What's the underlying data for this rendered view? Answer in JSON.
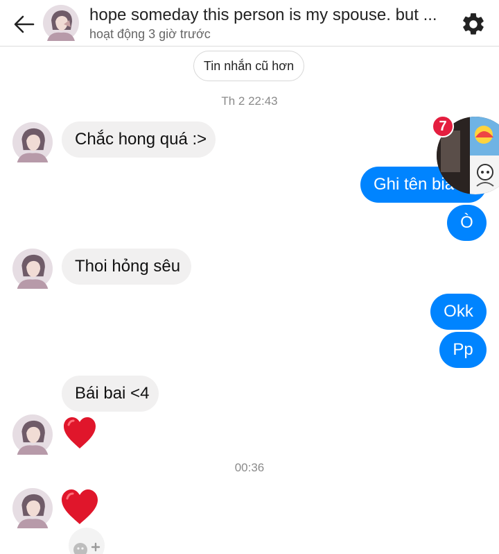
{
  "header": {
    "title": "hope someday this person is my spouse. but ...",
    "status": "hoạt động 3 giờ trước"
  },
  "older_messages_label": "Tin nhắn cũ hơn",
  "timestamps": [
    "Th 2 22:43",
    "00:36"
  ],
  "messages": [
    {
      "from": "them",
      "text": "Chắc hong quá :>"
    },
    {
      "from": "me",
      "text": "Ghi tên bia"
    },
    {
      "from": "me",
      "text": "Ò"
    },
    {
      "from": "them",
      "text": "Thoi hỏng sêu"
    },
    {
      "from": "me",
      "text": "Okk"
    },
    {
      "from": "me",
      "text": "Pp"
    },
    {
      "from": "them",
      "text": "Bái bai <4"
    },
    {
      "from": "them",
      "emoji": "heart"
    },
    {
      "from": "them",
      "emoji": "heart"
    }
  ],
  "chat_head": {
    "unread_count": "7"
  },
  "colors": {
    "outgoing": "#0084ff",
    "incoming": "#f1f0f0",
    "heart": "#e0162b",
    "badge": "#e41e3f"
  }
}
